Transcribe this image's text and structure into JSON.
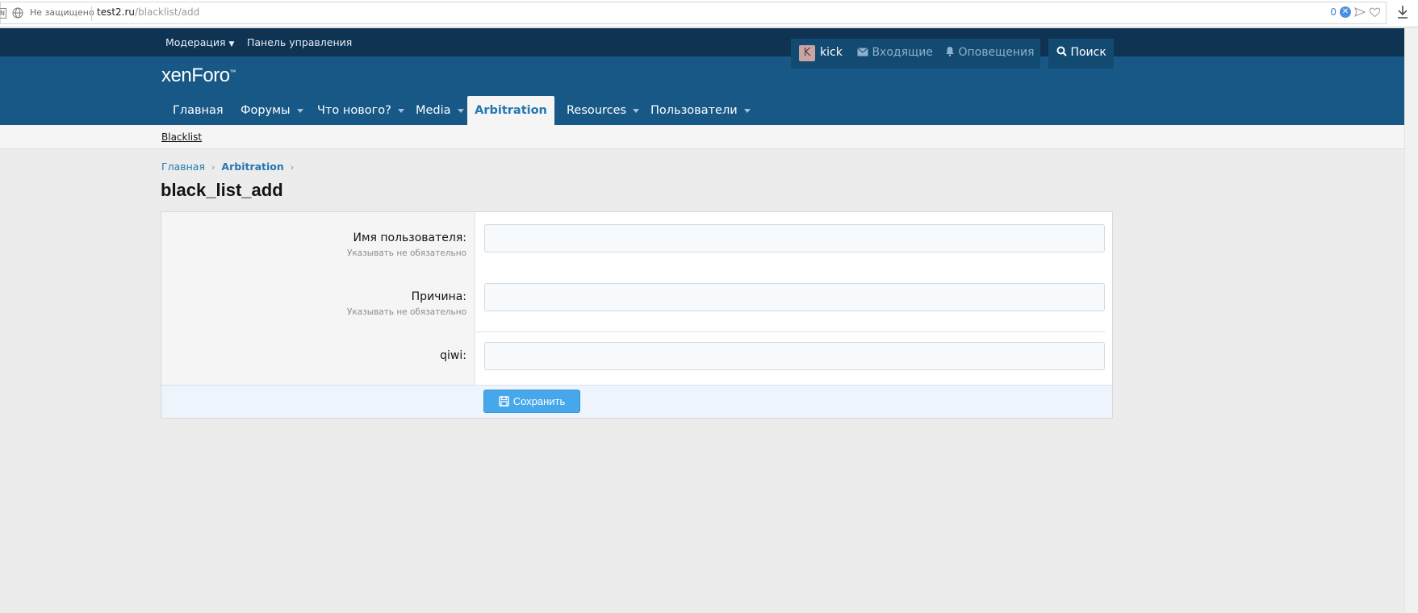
{
  "browser": {
    "extension_label": "N",
    "security_text": "Не защищено",
    "url_host": "test2.ru",
    "url_path": "/blacklist/add",
    "blocked_count": "0"
  },
  "staff_bar": {
    "moderation_label": "Модерация",
    "admin_panel_label": "Панель управления"
  },
  "header": {
    "logo_text": "xenForo",
    "logo_mark": "™",
    "nav_tabs": [
      {
        "label": "Главная"
      },
      {
        "label": "Форумы"
      },
      {
        "label": "Что нового?"
      },
      {
        "label": "Media"
      },
      {
        "label": "Arbitration"
      },
      {
        "label": "Resources"
      },
      {
        "label": "Пользователи"
      }
    ],
    "active_tab": "Arbitration",
    "user": {
      "avatar_letter": "K",
      "name": "kick"
    },
    "inbox_label": "Входящие",
    "alerts_label": "Оповещения",
    "search_label": "Поиск"
  },
  "subnav": {
    "link": "Blacklist"
  },
  "breadcrumb": {
    "items": [
      "Главная",
      "Arbitration"
    ]
  },
  "page_title": "black_list_add",
  "form": {
    "fields": [
      {
        "label": "Имя пользователя:",
        "hint": "Указывать не обязательно",
        "value": ""
      },
      {
        "label": "Причина:",
        "hint": "Указывать не обязательно",
        "value": ""
      },
      {
        "label": "qiwi:",
        "hint": "",
        "value": ""
      }
    ],
    "submit_label": "Сохранить"
  },
  "colors": {
    "staff_bar": "#0f3352",
    "header": "#185886",
    "accent": "#2577b1",
    "button": "#47a7eb"
  }
}
